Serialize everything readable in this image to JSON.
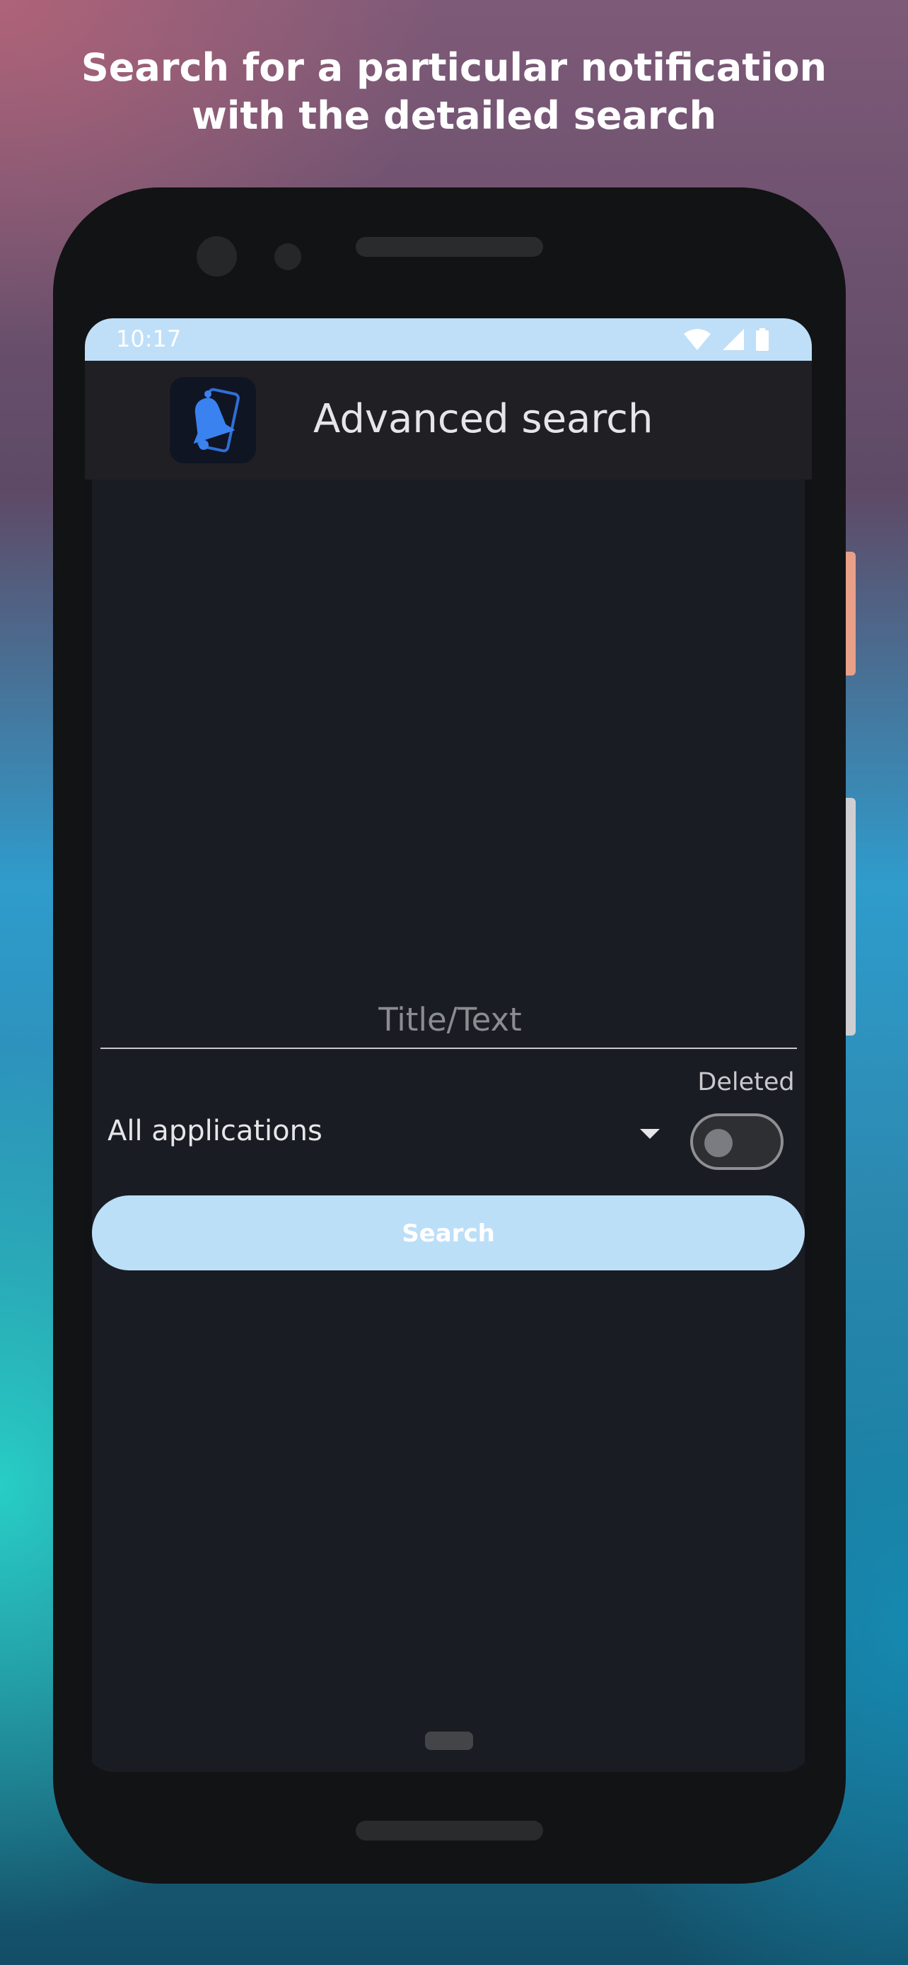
{
  "headline": {
    "line1": "Search for a particular notification",
    "line2": "with the detailed search"
  },
  "status_bar": {
    "time": "10:17",
    "icons": [
      "wifi-icon",
      "cellular-signal-icon",
      "battery-icon"
    ]
  },
  "app_bar": {
    "logo_icon": "bell-phone-logo-icon",
    "title": "Advanced search"
  },
  "search": {
    "placeholder": "Title/Text",
    "value": ""
  },
  "app_filter": {
    "selected": "All applications",
    "icon": "dropdown-arrow-icon"
  },
  "deleted_toggle": {
    "label": "Deleted",
    "checked": false
  },
  "search_button": {
    "label": "Search"
  },
  "colors": {
    "accent": "#bcdff8",
    "screen_bg": "#1a1c24",
    "appbar_bg": "#202024",
    "logo_blue": "#3a82f0"
  }
}
